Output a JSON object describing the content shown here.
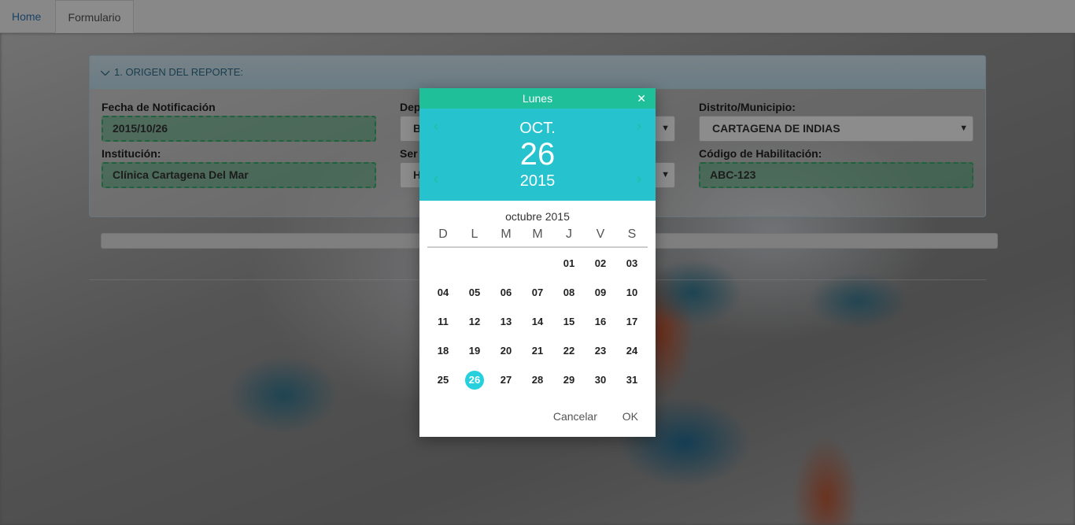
{
  "nav": {
    "home": "Home",
    "form": "Formulario"
  },
  "panel": {
    "title": "1. ORIGEN DEL REPORTE:"
  },
  "fields": {
    "fecha": {
      "label": "Fecha de Notificación",
      "value": "2015/10/26"
    },
    "institucion": {
      "label": "Institución:",
      "value": "Clínica Cartagena Del Mar"
    },
    "departamento": {
      "label": "Dep",
      "value": "B"
    },
    "servicio": {
      "label": "Ser",
      "value": "H"
    },
    "distrito": {
      "label": "Distrito/Municipio:",
      "value": "CARTAGENA DE INDIAS"
    },
    "codigo": {
      "label": "Código de Habilitación:",
      "value": "ABC-123"
    }
  },
  "picker": {
    "weekday": "Lunes",
    "month": "OCT.",
    "day": "26",
    "year": "2015",
    "caption": "octubre 2015",
    "weekdays": [
      "D",
      "L",
      "M",
      "M",
      "J",
      "V",
      "S"
    ],
    "weeks": [
      [
        "",
        "",
        "",
        "",
        "01",
        "02",
        "03"
      ],
      [
        "04",
        "05",
        "06",
        "07",
        "08",
        "09",
        "10"
      ],
      [
        "11",
        "12",
        "13",
        "14",
        "15",
        "16",
        "17"
      ],
      [
        "18",
        "19",
        "20",
        "21",
        "22",
        "23",
        "24"
      ],
      [
        "25",
        "26",
        "27",
        "28",
        "29",
        "30",
        "31"
      ]
    ],
    "selected": "26",
    "cancel": "Cancelar",
    "ok": "OK"
  },
  "icons": {
    "close": "close-icon",
    "prev": "chevron-left-icon",
    "next": "chevron-right-icon",
    "collapse": "chevron-down-icon",
    "dropdown": "caret-down-icon"
  },
  "colors": {
    "picker_top": "#1fbf9a",
    "picker_head": "#26c3cf",
    "selected_day": "#26d0dc",
    "valid_field": "#3cb371"
  }
}
